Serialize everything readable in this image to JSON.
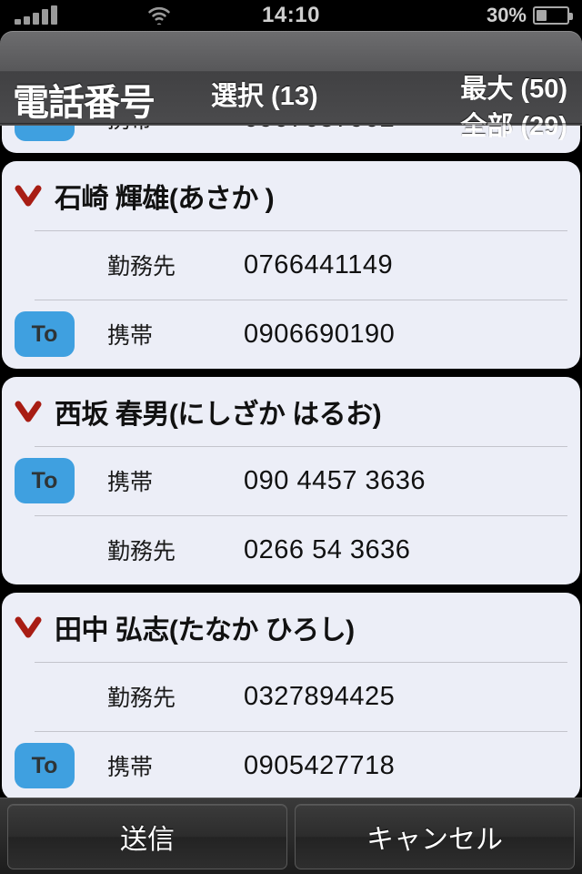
{
  "status_bar": {
    "signal_bars": 5,
    "wifi_icon": "wifi-icon",
    "time": "14:10",
    "battery_percent_label": "30%",
    "battery_level": 30
  },
  "header": {
    "title": "電話番号",
    "center_label": "選択 (13)",
    "right_top_label": "最大 (50)",
    "right_bottom_label": "全部 (29)"
  },
  "colors": {
    "to_badge": "#3fa0e0",
    "chevron": "#a81d14",
    "card_bg": "#eceef7",
    "page_bg": "#000000"
  },
  "list": {
    "cards": [
      {
        "name": "",
        "partial": true,
        "entries": [
          {
            "to_label": "To",
            "selected": true,
            "label": "携帯",
            "number": "0907637902"
          }
        ]
      },
      {
        "name": "石崎 輝雄(あさか )",
        "partial": false,
        "entries": [
          {
            "to_label": "To",
            "selected": false,
            "label": "勤務先",
            "number": "0766441149"
          },
          {
            "to_label": "To",
            "selected": true,
            "label": "携帯",
            "number": "0906690190"
          }
        ]
      },
      {
        "name": "西坂 春男(にしざか はるお)",
        "partial": false,
        "entries": [
          {
            "to_label": "To",
            "selected": true,
            "label": "携帯",
            "number": "090 4457 3636"
          },
          {
            "to_label": "To",
            "selected": false,
            "label": "勤務先",
            "number": "0266 54 3636"
          }
        ]
      },
      {
        "name": "田中 弘志(たなか ひろし)",
        "partial": false,
        "entries": [
          {
            "to_label": "To",
            "selected": false,
            "label": "勤務先",
            "number": "0327894425"
          },
          {
            "to_label": "To",
            "selected": true,
            "label": "携帯",
            "number": "0905427718"
          }
        ]
      }
    ]
  },
  "toolbar": {
    "send_label": "送信",
    "cancel_label": "キャンセル"
  }
}
